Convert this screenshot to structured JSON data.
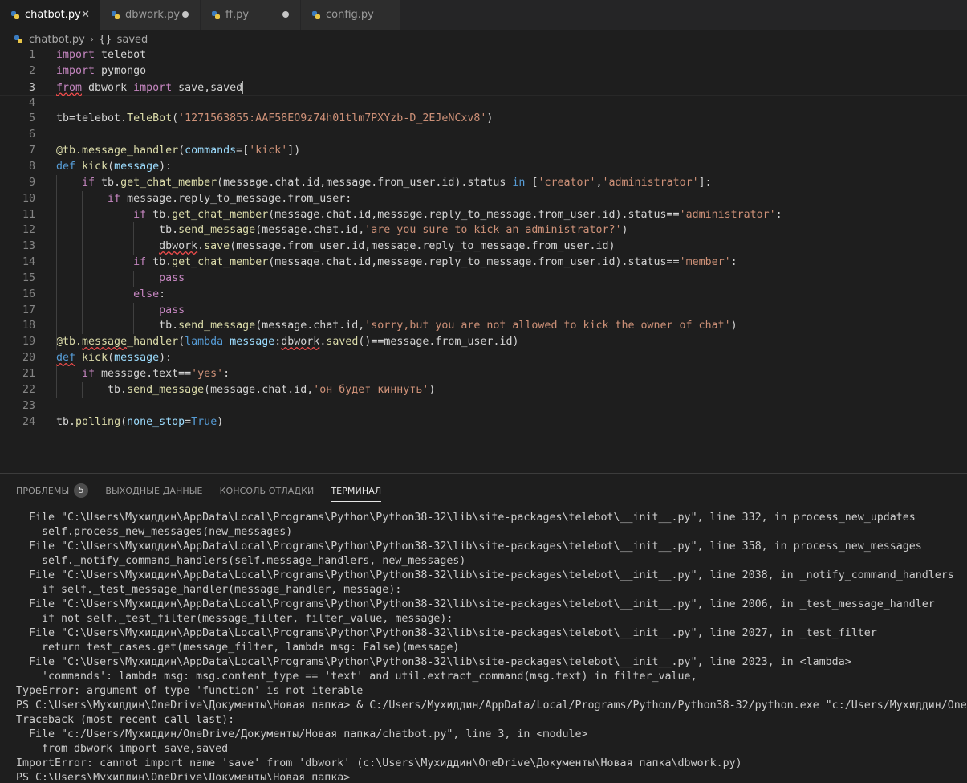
{
  "tabs": [
    {
      "label": "chatbot.py",
      "active": true,
      "state": "close"
    },
    {
      "label": "dbwork.py",
      "active": false,
      "state": "modified"
    },
    {
      "label": "ff.py",
      "active": false,
      "state": "modified"
    },
    {
      "label": "config.py",
      "active": false,
      "state": "none"
    }
  ],
  "breadcrumb": {
    "file": "chatbot.py",
    "symbol": "saved"
  },
  "editor": {
    "current_line": 3,
    "lines": [
      {
        "n": "1",
        "html": "<span class='kw'>import</span> telebot"
      },
      {
        "n": "2",
        "html": "<span class='kw'>import</span> pymongo"
      },
      {
        "n": "3",
        "html": "<span class='kw sq'>from</span> dbwork <span class='kw'>import</span> save,saved<span class='cursor'></span>"
      },
      {
        "n": "4",
        "html": ""
      },
      {
        "n": "5",
        "html": "tb=telebot.<span class='fn'>TeleBot</span>(<span class='str'>'1271563855:AAF58EO9z74h01tlm7PXYzb-D_2EJeNCxv8'</span>)"
      },
      {
        "n": "6",
        "html": ""
      },
      {
        "n": "7",
        "html": "<span class='fn'>@tb.message_handler</span>(<span class='var'>commands</span>=[<span class='str'>'kick'</span>])"
      },
      {
        "n": "8",
        "html": "<span class='kw2'>def</span> <span class='fn'>kick</span>(<span class='var'>message</span>):"
      },
      {
        "n": "9",
        "html": "    <span class='kw'>if</span> tb.<span class='fn'>get_chat_member</span>(message.chat.id,message.from_user.id).status <span class='kw2'>in</span> [<span class='str'>'creator'</span>,<span class='str'>'administrator'</span>]:"
      },
      {
        "n": "10",
        "html": "        <span class='kw'>if</span> message.reply_to_message.from_user:"
      },
      {
        "n": "11",
        "html": "            <span class='kw'>if</span> tb.<span class='fn'>get_chat_member</span>(message.chat.id,message.reply_to_message.from_user.id).status==<span class='str'>'administrator'</span>:"
      },
      {
        "n": "12",
        "html": "                tb.<span class='fn'>send_message</span>(message.chat.id,<span class='str'>'are you sure to kick an administrator?'</span>)"
      },
      {
        "n": "13",
        "html": "                <span class='sq'>dbwork</span>.<span class='fn'>save</span>(message.from_user.id,message.reply_to_message.from_user.id)"
      },
      {
        "n": "14",
        "html": "            <span class='kw'>if</span> tb.<span class='fn'>get_chat_member</span>(message.chat.id,message.reply_to_message.from_user.id).status==<span class='str'>'member'</span>:"
      },
      {
        "n": "15",
        "html": "                <span class='kw'>pass</span>"
      },
      {
        "n": "16",
        "html": "            <span class='kw'>else</span>:"
      },
      {
        "n": "17",
        "html": "                <span class='kw'>pass</span>"
      },
      {
        "n": "18",
        "html": "                tb.<span class='fn'>send_message</span>(message.chat.id,<span class='str'>'sorry,but you are not allowed to kick the owner of chat'</span>)"
      },
      {
        "n": "19",
        "html": "<span class='fn'>@tb.<span class='sq'>message</span>_handler</span>(<span class='kw2'>lambda</span> <span class='var'>message</span>:<span class='sq'>dbwork</span>.<span class='fn'>saved</span>()==message.from_user.id)"
      },
      {
        "n": "20",
        "html": "<span class='kw2 sq'>def</span> <span class='fn'>kick</span>(<span class='var'>message</span>):"
      },
      {
        "n": "21",
        "html": "    <span class='kw'>if</span> message.text==<span class='str'>'yes'</span>:"
      },
      {
        "n": "22",
        "html": "        tb.<span class='fn'>send_message</span>(message.chat.id,<span class='str'>'он будет киннуть'</span>)"
      },
      {
        "n": "23",
        "html": ""
      },
      {
        "n": "24",
        "html": "tb.<span class='fn'>polling</span>(<span class='var'>none_stop</span>=<span class='kw2'>True</span>)"
      }
    ]
  },
  "panel": {
    "tabs": [
      {
        "label": "ПРОБЛЕМЫ",
        "badge": "5",
        "active": false
      },
      {
        "label": "ВЫХОДНЫЕ ДАННЫЕ",
        "active": false
      },
      {
        "label": "КОНСОЛЬ ОТЛАДКИ",
        "active": false
      },
      {
        "label": "ТЕРМИНАЛ",
        "active": true
      }
    ],
    "terminal_lines": [
      "  File \"C:\\Users\\Мухиддин\\AppData\\Local\\Programs\\Python\\Python38-32\\lib\\site-packages\\telebot\\__init__.py\", line 332, in process_new_updates",
      "    self.process_new_messages(new_messages)",
      "  File \"C:\\Users\\Мухиддин\\AppData\\Local\\Programs\\Python\\Python38-32\\lib\\site-packages\\telebot\\__init__.py\", line 358, in process_new_messages",
      "    self._notify_command_handlers(self.message_handlers, new_messages)",
      "  File \"C:\\Users\\Мухиддин\\AppData\\Local\\Programs\\Python\\Python38-32\\lib\\site-packages\\telebot\\__init__.py\", line 2038, in _notify_command_handlers",
      "    if self._test_message_handler(message_handler, message):",
      "  File \"C:\\Users\\Мухиддин\\AppData\\Local\\Programs\\Python\\Python38-32\\lib\\site-packages\\telebot\\__init__.py\", line 2006, in _test_message_handler",
      "    if not self._test_filter(message_filter, filter_value, message):",
      "  File \"C:\\Users\\Мухиддин\\AppData\\Local\\Programs\\Python\\Python38-32\\lib\\site-packages\\telebot\\__init__.py\", line 2027, in _test_filter",
      "    return test_cases.get(message_filter, lambda msg: False)(message)",
      "  File \"C:\\Users\\Мухиддин\\AppData\\Local\\Programs\\Python\\Python38-32\\lib\\site-packages\\telebot\\__init__.py\", line 2023, in <lambda>",
      "    'commands': lambda msg: msg.content_type == 'text' and util.extract_command(msg.text) in filter_value,",
      "TypeError: argument of type 'function' is not iterable",
      "PS C:\\Users\\Мухиддин\\OneDrive\\Документы\\Новая папка> & C:/Users/Мухиддин/AppData/Local/Programs/Python/Python38-32/python.exe \"c:/Users/Мухиддин/OneDrive/Документы/Новая папка/chatbot.py\"",
      "Traceback (most recent call last):",
      "  File \"c:/Users/Мухиддин/OneDrive/Документы/Новая папка/chatbot.py\", line 3, in <module>",
      "    from dbwork import save,saved",
      "ImportError: cannot import name 'save' from 'dbwork' (c:\\Users\\Мухиддин\\OneDrive\\Документы\\Новая папка\\dbwork.py)",
      "PS C:\\Users\\Мухиддин\\OneDrive\\Документы\\Новая папка>"
    ]
  }
}
